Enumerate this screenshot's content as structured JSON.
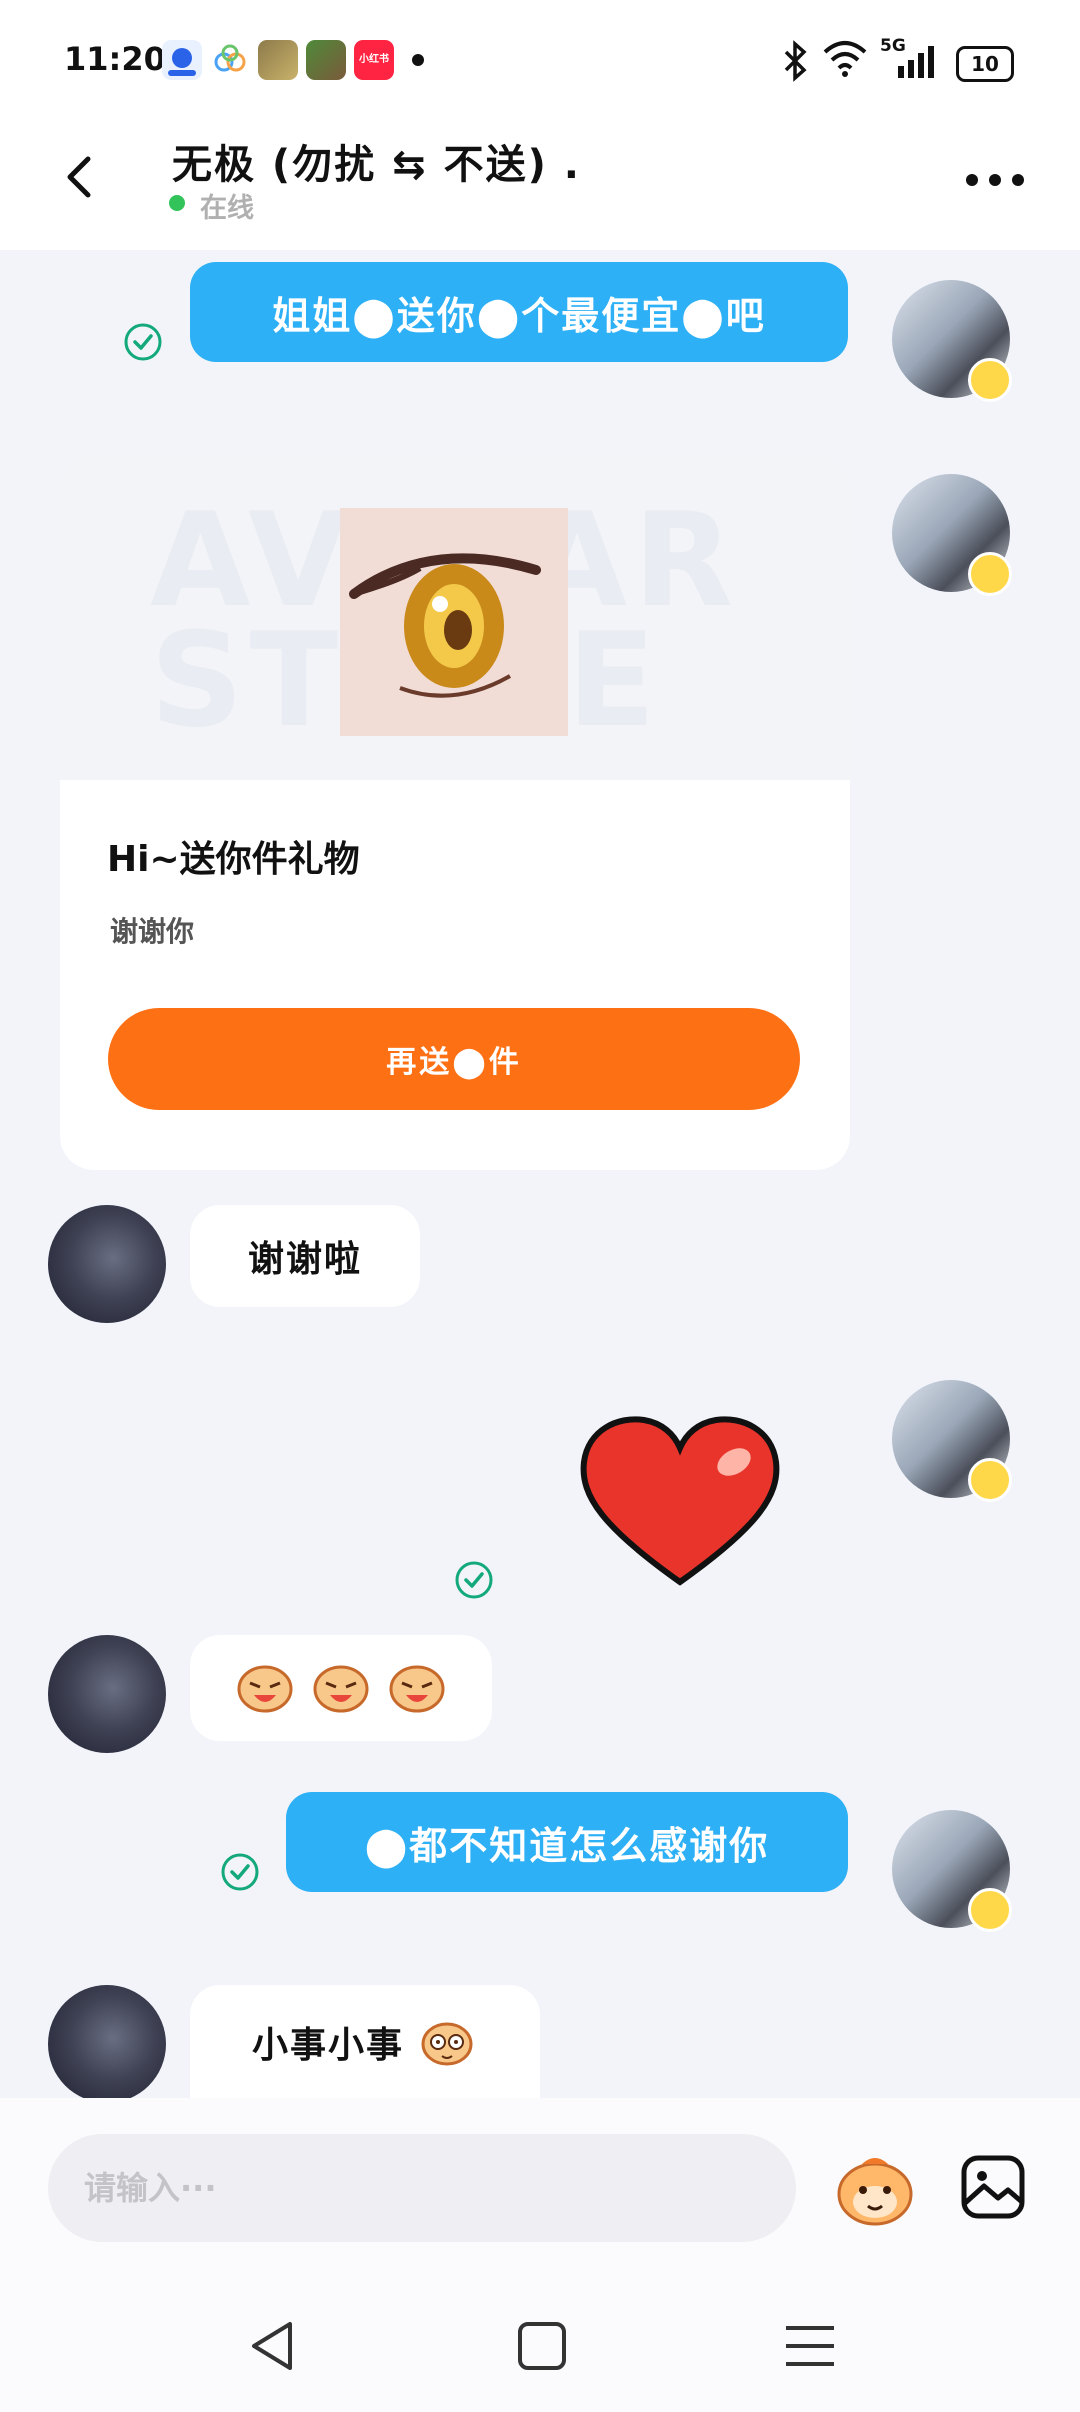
{
  "status_bar": {
    "time": "11:20",
    "app_icons": [
      "baidu-icon",
      "cloud-app-icon",
      "game-app-icon",
      "game2-app-icon",
      "xiaohongshu-icon"
    ],
    "app_icon_label_xhs": "小红书",
    "network": "5G",
    "battery": "10"
  },
  "header": {
    "contact_name": "无极 (勿扰 ⇆ 不送) .",
    "online_status": "在线"
  },
  "messages": [
    {
      "sender": "me",
      "type": "text",
      "text": "姐姐⬤送你⬤个最便宜⬤吧",
      "status": "read"
    },
    {
      "sender": "me",
      "type": "gift",
      "watermark": "AVATAR STORE",
      "title": "Hi~送你件礼物",
      "subtitle": "谢谢你",
      "button": "再送⬤件"
    },
    {
      "sender": "other",
      "type": "text",
      "text": "谢谢啦"
    },
    {
      "sender": "me",
      "type": "sticker",
      "sticker": "heart-sticker",
      "status": "read"
    },
    {
      "sender": "other",
      "type": "emoji",
      "emoji_count": 3
    },
    {
      "sender": "me",
      "type": "text",
      "text": "⬤都不知道怎么感谢你",
      "status": "read"
    },
    {
      "sender": "other",
      "type": "text",
      "text": "小事小事"
    }
  ],
  "input": {
    "placeholder": "请输入···"
  },
  "colors": {
    "accent_blue": "#2db0f5",
    "accent_orange": "#fd7014",
    "online_green": "#32c45a",
    "read_check": "#13a97a"
  }
}
